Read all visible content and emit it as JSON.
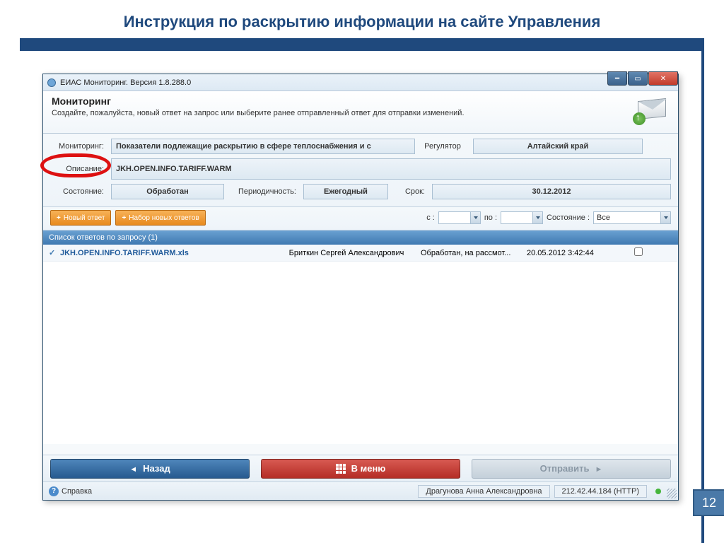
{
  "slide": {
    "title": "Инструкция по раскрытию информации на сайте Управления",
    "page": "12"
  },
  "window": {
    "title": "ЕИАС Мониторинг. Версия 1.8.288.0",
    "header": {
      "title": "Мониторинг",
      "subtitle": "Создайте, пожалуйста, новый ответ на запрос или выберите ранее отправленный ответ для отправки изменений."
    },
    "labels": {
      "monitoring": "Мониторинг:",
      "regulator": "Регулятор",
      "description": "Описание:",
      "state": "Состояние:",
      "periodicity": "Периодичность:",
      "term": "Срок:",
      "from": "с :",
      "to": "по :",
      "stateFilter": "Состояние :"
    },
    "values": {
      "monitoring": "Показатели подлежащие раскрытию в сфере теплоснабжения и с",
      "regulator": "Алтайский край",
      "description": "JKH.OPEN.INFO.TARIFF.WARM",
      "state": "Обработан",
      "periodicity": "Ежегодный",
      "term": "30.12.2012",
      "stateFilter": "Все"
    },
    "buttons": {
      "newAnswer": "Новый ответ",
      "newAnswersSet": "Набор новых ответов"
    },
    "list": {
      "header": "Список ответов по запросу (1)",
      "rows": [
        {
          "file": "JKH.OPEN.INFO.TARIFF.WARM.xls",
          "user": "Бриткин Сергей Александрович",
          "state": "Обработан, на рассмот...",
          "date": "20.05.2012 3:42:44"
        }
      ]
    },
    "nav": {
      "back": "Назад",
      "menu": "В меню",
      "send": "Отправить"
    },
    "status": {
      "help": "Справка",
      "user": "Драгунова Анна Александровна",
      "conn": "212.42.44.184 (HTTP)"
    }
  }
}
